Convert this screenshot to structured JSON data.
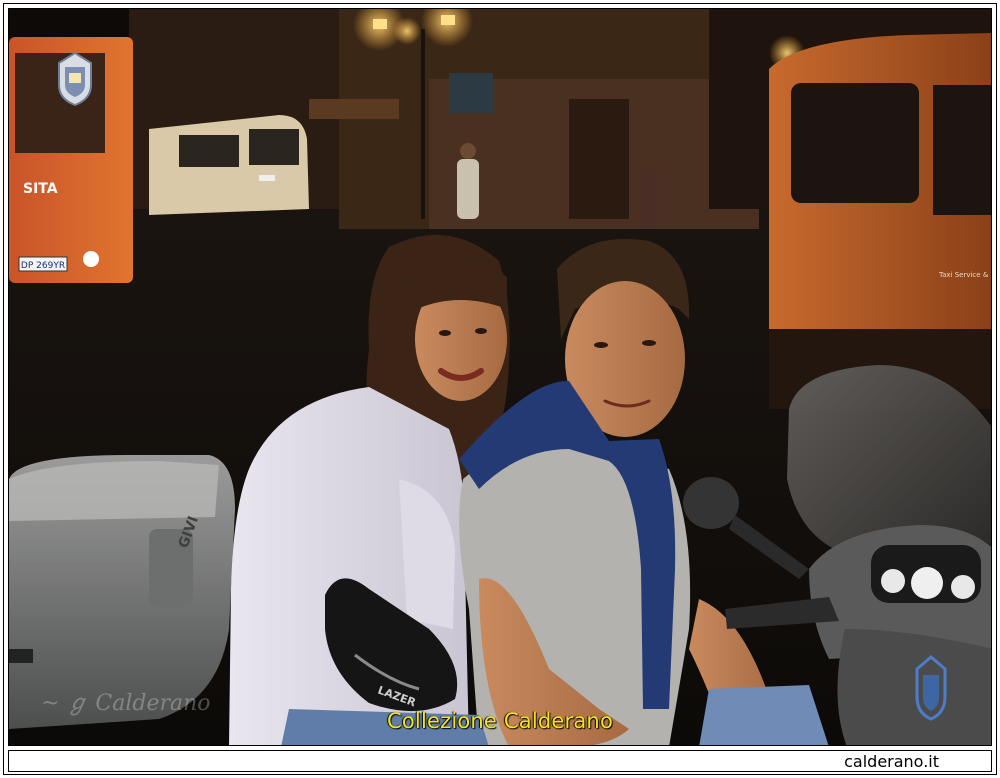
{
  "photo": {
    "watermark_caption": "Collezione Calderano",
    "bus_brand": "SITA",
    "bus_plate": "DP 269YR",
    "helmet_brand": "LAZER",
    "topcase_brand": "GIVI",
    "van_side_text": "Taxi Service & Rent a Car"
  },
  "footer": {
    "site_name": "calderano.it"
  }
}
